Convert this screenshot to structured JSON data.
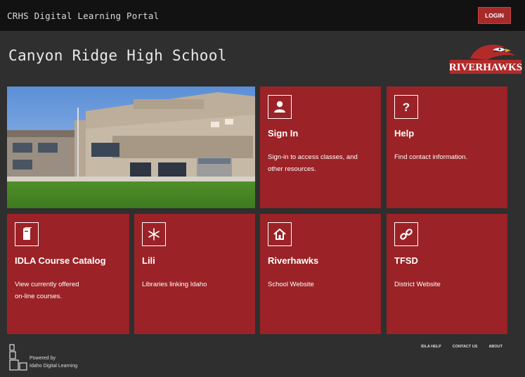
{
  "topbar": {
    "title": "CRHS Digital Learning Portal",
    "login_label": "LOGIN"
  },
  "header": {
    "school_name": "Canyon Ridge High School",
    "logo_text": "RIVERHAWKS"
  },
  "tiles": [
    {
      "title": "Sign In",
      "desc": "Sign-in to access classes, and\nother resources.",
      "icon": "user-icon"
    },
    {
      "title": "Help",
      "desc": "Find contact information.",
      "icon": "question-icon"
    },
    {
      "title": "IDLA Course Catalog",
      "desc": "View currently offered\non-line courses.",
      "icon": "book-icon"
    },
    {
      "title": "Lili",
      "desc": "Libraries linking Idaho",
      "icon": "asterisk-icon"
    },
    {
      "title": "Riverhawks",
      "desc": "School Website",
      "icon": "home-icon"
    },
    {
      "title": "TFSD",
      "desc": "District Website",
      "icon": "link-icon"
    }
  ],
  "footer": {
    "links": [
      "IDLA HELP",
      "CONTACT US",
      "ABOUT"
    ],
    "powered_line1": "Powered by",
    "powered_line2": "Idaho Digital Learning"
  },
  "colors": {
    "tile": "#9b2226",
    "topbar": "#121212",
    "background": "#2f2f2f",
    "login": "#a72a2a"
  }
}
